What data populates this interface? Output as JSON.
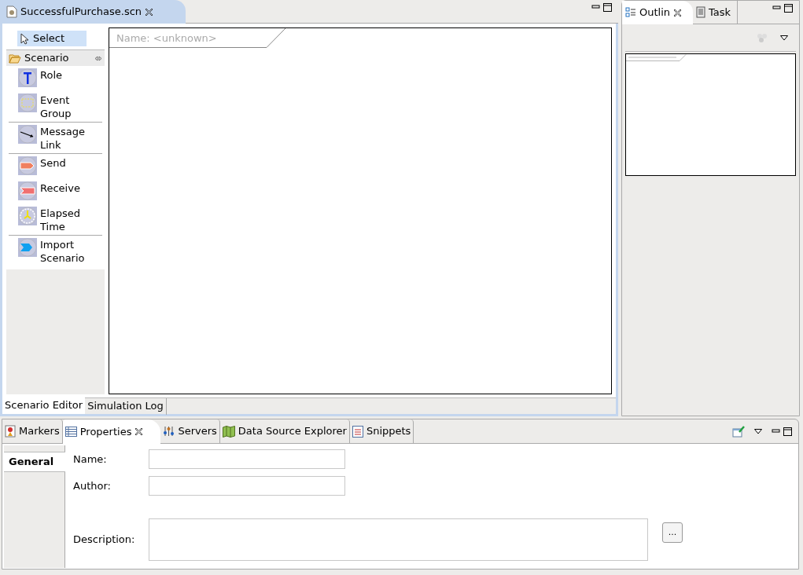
{
  "editor": {
    "tabs": [
      {
        "label": "SuccessfulPurchase.scn",
        "selected": true
      }
    ],
    "palette": {
      "select": {
        "label": "Select",
        "selected": true
      },
      "drawer": {
        "label": "Scenario",
        "expanded": true
      },
      "groups": [
        [
          {
            "label": "Role"
          },
          {
            "label": "Event Group"
          }
        ],
        [
          {
            "label": "Message Link"
          }
        ],
        [
          {
            "label": "Send"
          },
          {
            "label": "Receive"
          },
          {
            "label": "Elapsed Time"
          }
        ],
        [
          {
            "label": "Import Scenario"
          }
        ]
      ]
    },
    "canvas": {
      "name_label": "Name: <unknown>"
    },
    "bottom_tabs": [
      {
        "label": "Scenario Editor",
        "selected": true
      },
      {
        "label": "Simulation Log",
        "selected": false
      }
    ]
  },
  "outline": {
    "tabs": [
      {
        "label": "Outlin",
        "selected": true
      },
      {
        "label": "Task",
        "selected": false
      }
    ]
  },
  "properties": {
    "tabs": [
      {
        "label": "Markers",
        "selected": false
      },
      {
        "label": "Properties",
        "selected": true
      },
      {
        "label": "Servers",
        "selected": false
      },
      {
        "label": "Data Source Explorer",
        "selected": false
      },
      {
        "label": "Snippets",
        "selected": false
      }
    ],
    "side_tabs": [
      {
        "label": "General",
        "selected": true
      }
    ],
    "fields": [
      {
        "label": "Name:",
        "kind": "line"
      },
      {
        "label": "Author:",
        "kind": "line"
      },
      {
        "label": "Description:",
        "kind": "area",
        "button": "..."
      }
    ]
  }
}
